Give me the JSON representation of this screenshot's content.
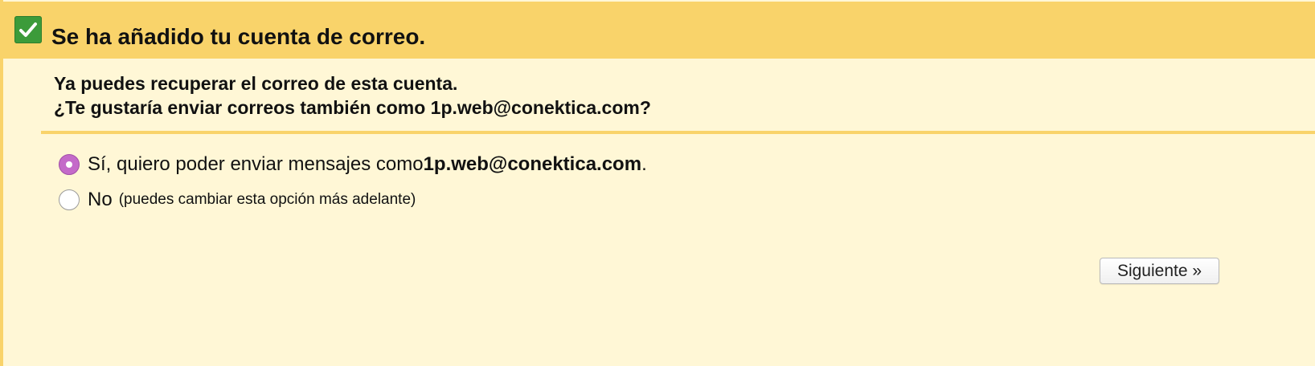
{
  "header": {
    "title": "Se ha añadido tu cuenta de correo.",
    "icon": "checkmark-icon",
    "color": "#f9d36a",
    "check_color": "#3c9b3a"
  },
  "intro": {
    "line1": "Ya puedes recuperar el correo de esta cuenta.",
    "line2": "¿Te gustaría enviar correos también como 1p.web@conektica.com?"
  },
  "options": {
    "yes": {
      "label": "Sí, quiero poder enviar mensajes como ",
      "email": "1p.web@conektica.com",
      "suffix": ".",
      "checked": true
    },
    "no": {
      "label": "No",
      "note": "(puedes cambiar esta opción más adelante)",
      "checked": false
    }
  },
  "actions": {
    "next_label": "Siguiente »"
  },
  "colors": {
    "background": "#fff7d6",
    "radio_selected": "#c46ac9"
  }
}
